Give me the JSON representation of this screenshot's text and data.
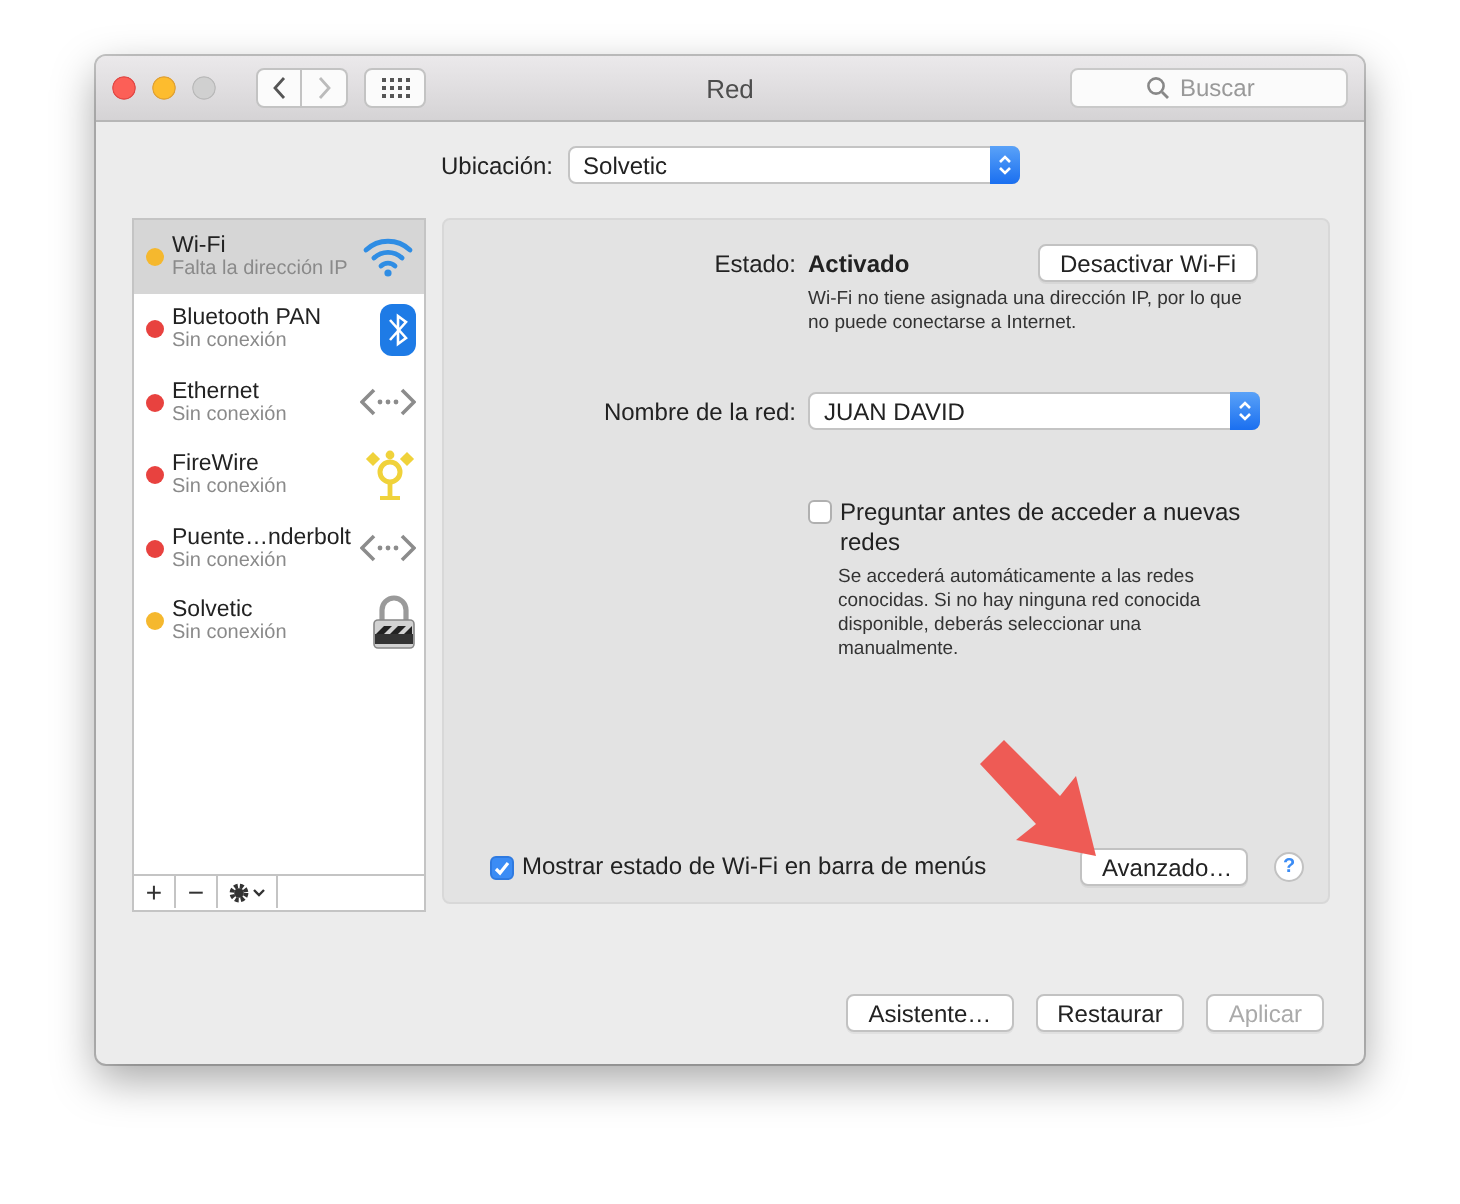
{
  "window": {
    "title": "Red",
    "search": {
      "placeholder": "Buscar"
    }
  },
  "location": {
    "label": "Ubicación:",
    "value": "Solvetic"
  },
  "sidebar": {
    "items": [
      {
        "name": "Wi-Fi",
        "status": "Falta la dirección IP",
        "color": "#f5b82e",
        "kind": "wifi",
        "selected": true
      },
      {
        "name": "Bluetooth PAN",
        "status": "Sin conexión",
        "color": "#e8423f",
        "kind": "bluetooth",
        "selected": false
      },
      {
        "name": "Ethernet",
        "status": "Sin conexión",
        "color": "#e8423f",
        "kind": "ethernet",
        "selected": false
      },
      {
        "name": "FireWire",
        "status": "Sin conexión",
        "color": "#e8423f",
        "kind": "firewire",
        "selected": false
      },
      {
        "name": "Puente…nderbolt",
        "status": "Sin conexión",
        "color": "#e8423f",
        "kind": "ethernet",
        "selected": false
      },
      {
        "name": "Solvetic",
        "status": "Sin conexión",
        "color": "#f5b82e",
        "kind": "lock",
        "selected": false
      }
    ],
    "footer": [
      "+",
      "−"
    ]
  },
  "detail": {
    "status_label": "Estado:",
    "status_value": "Activado",
    "toggle_button": "Desactivar Wi-Fi",
    "status_note": "Wi-Fi no tiene asignada una dirección IP, por lo que no puede conectarse a Internet.",
    "network_label": "Nombre de la red:",
    "network_value": "JUAN DAVID",
    "ask_checkbox": {
      "label": "Preguntar antes de acceder a nuevas redes",
      "checked": false
    },
    "ask_note": "Se accederá automáticamente a las redes conocidas. Si no hay ninguna red conocida disponible, deberás seleccionar una manualmente.",
    "menu_checkbox": {
      "label": "Mostrar estado de Wi-Fi en barra de menús",
      "checked": true
    },
    "advanced_button": "Avanzado…",
    "help": "?"
  },
  "buttons": [
    {
      "label": "Asistente…",
      "disabled": false
    },
    {
      "label": "Restaurar",
      "disabled": false
    },
    {
      "label": "Aplicar",
      "disabled": true
    }
  ]
}
